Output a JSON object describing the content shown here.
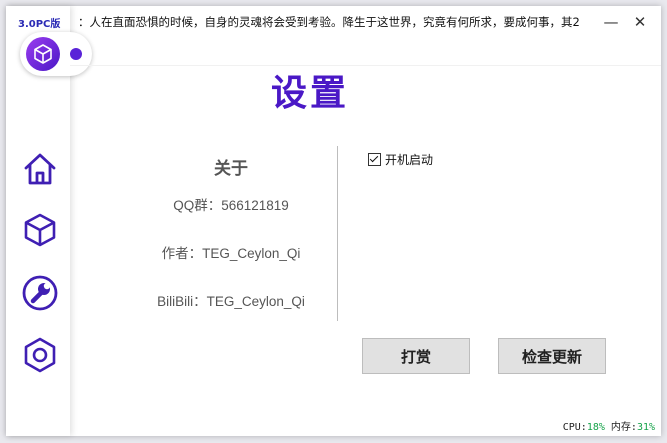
{
  "app": {
    "version_label": "3.0PC版",
    "ticker_text": "：人在直面恐惧的时候，自身的灵魂将会受到考验。降生于这世界，究竟有何所求，要成何事，其2"
  },
  "window_controls": {
    "minimize": "—",
    "close": "✕"
  },
  "sidebar": {
    "items": [
      {
        "name": "home",
        "icon": "home-icon"
      },
      {
        "name": "cube",
        "icon": "cube-icon"
      },
      {
        "name": "tools",
        "icon": "wrench-icon"
      },
      {
        "name": "settings",
        "icon": "hexagon-icon"
      }
    ]
  },
  "page": {
    "title": "设置"
  },
  "about": {
    "heading": "关于",
    "qq_group": "QQ群：566121819",
    "author": "作者：TEG_Ceylon_Qi",
    "bilibili": "BiliBili：TEG_Ceylon_Qi"
  },
  "options": {
    "autostart_label": "开机启动",
    "autostart_checked": true
  },
  "buttons": {
    "donate": "打赏",
    "check_update": "检查更新"
  },
  "status": {
    "cpu_label": "CPU:",
    "cpu_value": "18%",
    "mem_label": "内存:",
    "mem_value": "31%"
  },
  "colors": {
    "brand": "#4a18c6",
    "icon_purple": "#3f1fb3",
    "status_value": "#16a34a"
  }
}
